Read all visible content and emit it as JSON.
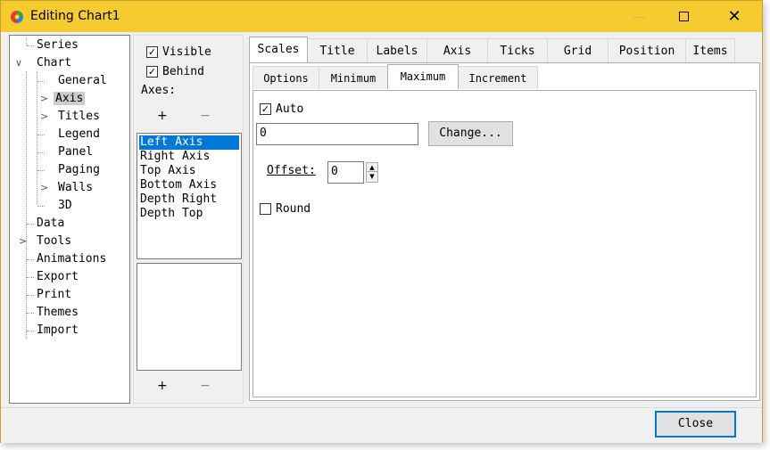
{
  "window": {
    "title": "Editing Chart1"
  },
  "tree": {
    "items": [
      {
        "label": "Series"
      },
      {
        "label": "Chart"
      },
      {
        "label": "General"
      },
      {
        "label": "Axis"
      },
      {
        "label": "Titles"
      },
      {
        "label": "Legend"
      },
      {
        "label": "Panel"
      },
      {
        "label": "Paging"
      },
      {
        "label": "Walls"
      },
      {
        "label": "3D"
      },
      {
        "label": "Data"
      },
      {
        "label": "Tools"
      },
      {
        "label": "Animations"
      },
      {
        "label": "Export"
      },
      {
        "label": "Print"
      },
      {
        "label": "Themes"
      },
      {
        "label": "Import"
      }
    ]
  },
  "axes_panel": {
    "visible_label": "Visible",
    "visible_checked": true,
    "behind_label": "Behind",
    "behind_checked": true,
    "axes_label": "Axes:",
    "add_label": "+",
    "remove_label": "−",
    "axes_list": [
      "Left Axis",
      "Right Axis",
      "Top Axis",
      "Bottom Axis",
      "Depth Right",
      "Depth Top"
    ],
    "add2_label": "+",
    "remove2_label": "−"
  },
  "tabs": [
    "Scales",
    "Title",
    "Labels",
    "Axis",
    "Ticks",
    "Grid",
    "Position",
    "Items"
  ],
  "subtabs": [
    "Options",
    "Minimum",
    "Maximum",
    "Increment"
  ],
  "maximum": {
    "auto_label": "Auto",
    "auto_checked": true,
    "value": "0",
    "change_label": "Change...",
    "offset_label": "Offset:",
    "offset_value": "0",
    "round_label": "Round",
    "round_checked": false
  },
  "footer": {
    "close_label": "Close"
  }
}
